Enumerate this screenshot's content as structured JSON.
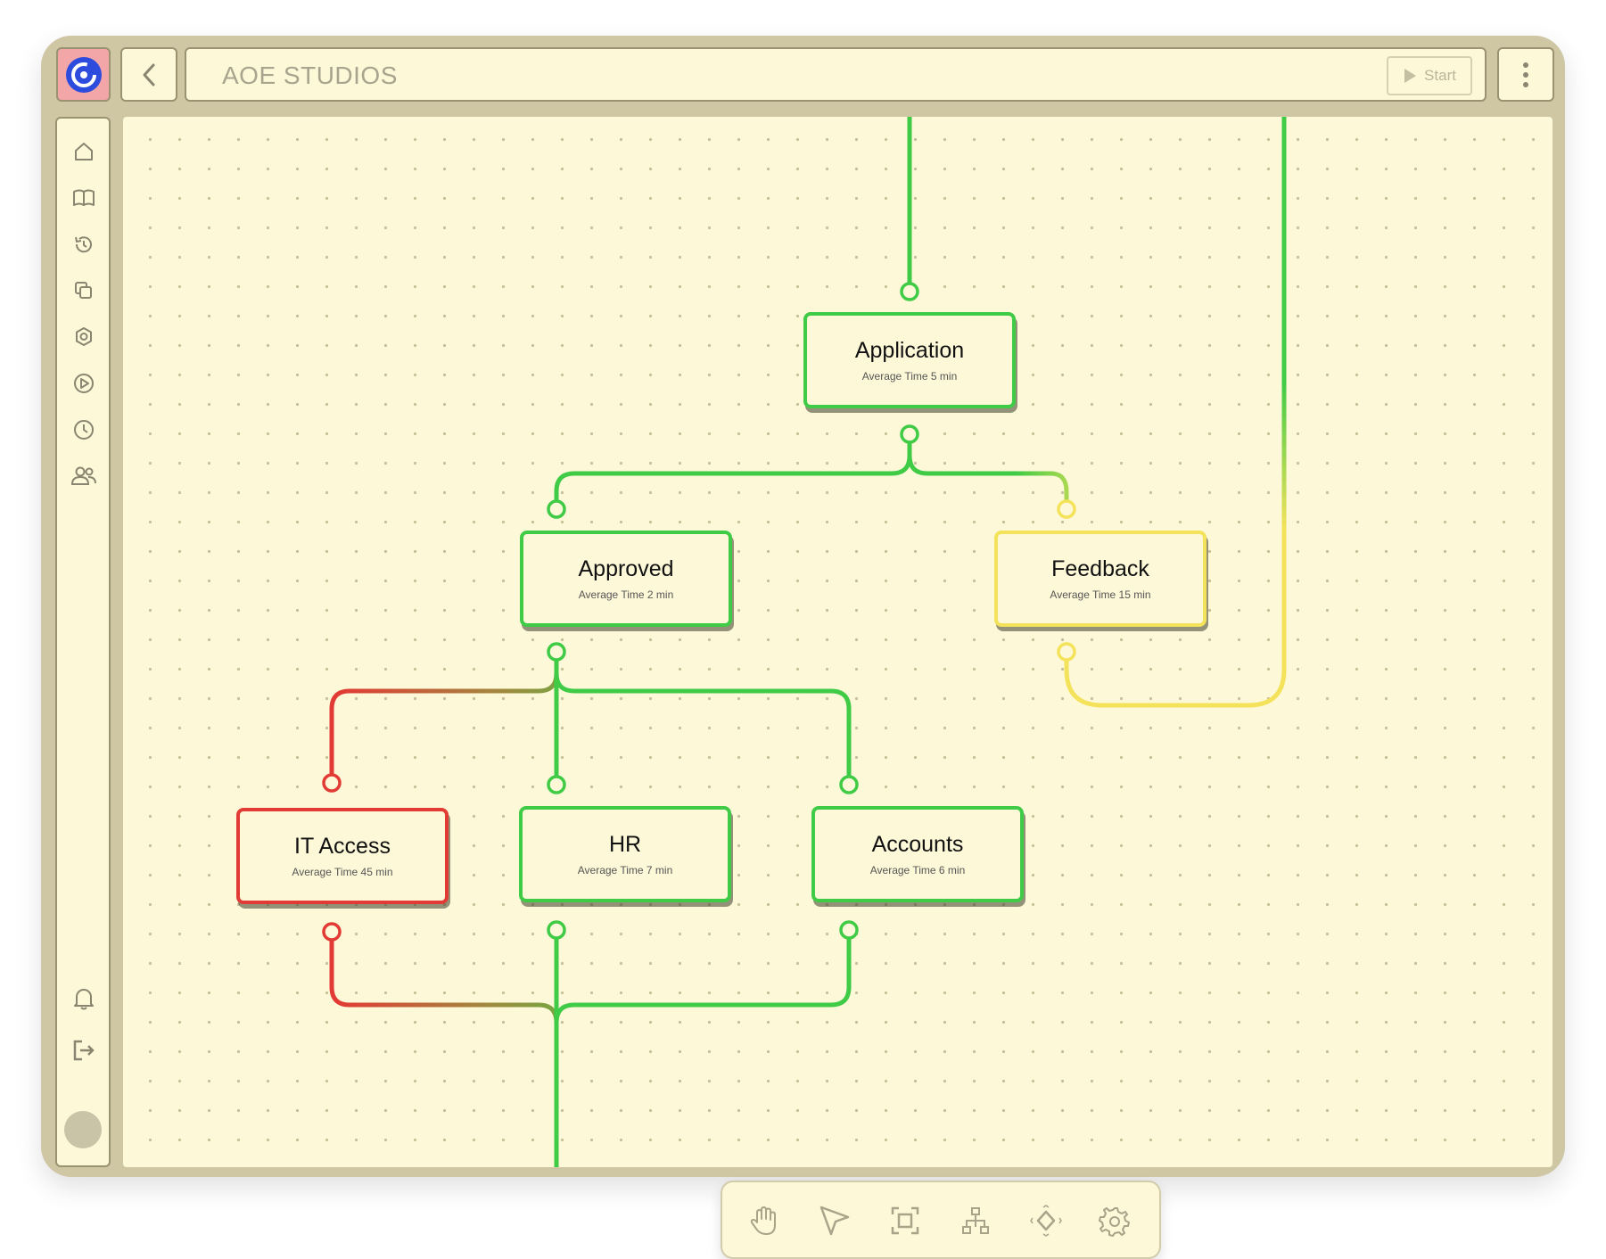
{
  "header": {
    "app_title": "AOE STUDIOS",
    "start_label": "Start"
  },
  "sidebar": {
    "items": [
      {
        "icon": "home-icon"
      },
      {
        "icon": "book-icon"
      },
      {
        "icon": "history-icon"
      },
      {
        "icon": "copy-icon"
      },
      {
        "icon": "settings-icon"
      },
      {
        "icon": "play-icon"
      },
      {
        "icon": "clock-icon"
      },
      {
        "icon": "users-icon"
      }
    ],
    "bottom": [
      {
        "icon": "bell-icon"
      },
      {
        "icon": "logout-icon"
      }
    ]
  },
  "flow": {
    "nodes": [
      {
        "id": "application",
        "name": "Application",
        "avg": "Average Time 5 min",
        "status": "green"
      },
      {
        "id": "approved",
        "name": "Approved",
        "avg": "Average Time 2 min",
        "status": "green"
      },
      {
        "id": "feedback",
        "name": "Feedback",
        "avg": "Average Time 15 min",
        "status": "yellow"
      },
      {
        "id": "it_access",
        "name": "IT Access",
        "avg": "Average Time 45 min",
        "status": "red"
      },
      {
        "id": "hr",
        "name": "HR",
        "avg": "Average Time 7 min",
        "status": "green"
      },
      {
        "id": "accounts",
        "name": "Accounts",
        "avg": "Average Time 6 min",
        "status": "green"
      }
    ]
  },
  "colors": {
    "green": "#3fcb46",
    "yellow": "#f3e25a",
    "red": "#e23a34",
    "canvas": "#fdf8d8",
    "frame": "#cfc7a4"
  },
  "toolbar": {
    "tools": [
      {
        "icon": "hand-icon"
      },
      {
        "icon": "pointer-icon"
      },
      {
        "icon": "frame-select-icon"
      },
      {
        "icon": "hierarchy-icon"
      },
      {
        "icon": "diamond-node-icon"
      },
      {
        "icon": "gear-icon"
      }
    ]
  }
}
